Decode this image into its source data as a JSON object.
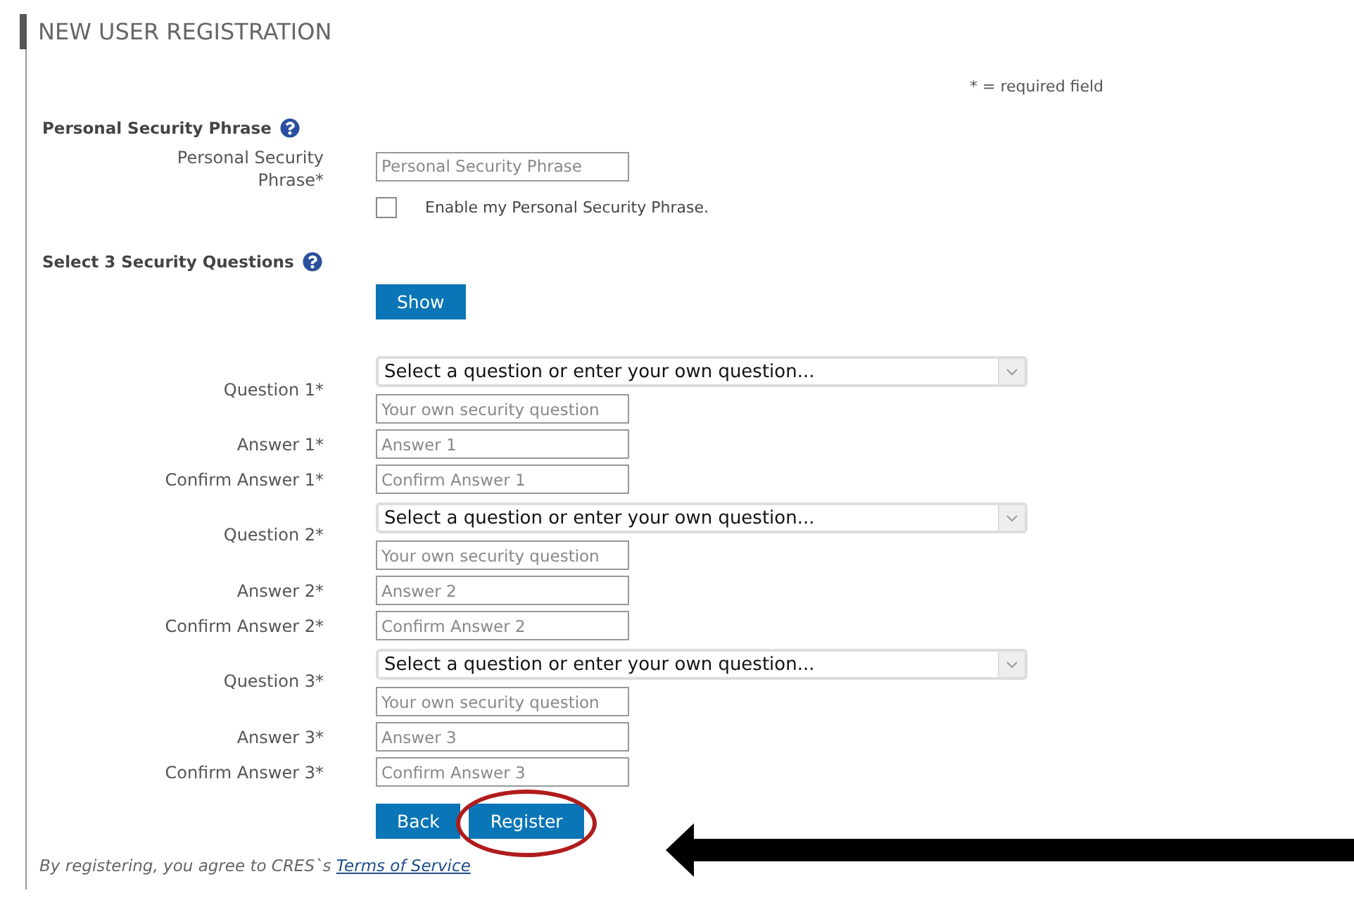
{
  "title": "NEW USER REGISTRATION",
  "required_note": "* = required field",
  "personal_phrase": {
    "heading": "Personal Security Phrase",
    "label": "Personal Security Phrase*",
    "placeholder": "Personal Security Phrase",
    "checkbox": {
      "label": "Enable my Personal Security Phrase.",
      "checked": false
    }
  },
  "security_questions": {
    "heading": "Select 3 Security Questions",
    "show_button": "Show",
    "questions": [
      {
        "label": "Question 1*",
        "select_value": "Select a question or enter your own question...",
        "own_placeholder": "Your own security question",
        "answer_label": "Answer 1*",
        "answer_placeholder": "Answer 1",
        "confirm_label": "Confirm Answer 1*",
        "confirm_placeholder": "Confirm Answer 1"
      },
      {
        "label": "Question 2*",
        "select_value": "Select a question or enter your own question...",
        "own_placeholder": "Your own security question",
        "answer_label": "Answer 2*",
        "answer_placeholder": "Answer 2",
        "confirm_label": "Confirm Answer 2*",
        "confirm_placeholder": "Confirm Answer 2"
      },
      {
        "label": "Question 3*",
        "select_value": "Select a question or enter your own question...",
        "own_placeholder": "Your own security question",
        "answer_label": "Answer 3*",
        "answer_placeholder": "Answer 3",
        "confirm_label": "Confirm Answer 3*",
        "confirm_placeholder": "Confirm Answer 3"
      }
    ]
  },
  "buttons": [
    {
      "label": "Back",
      "highlighted": false
    },
    {
      "label": "Register",
      "highlighted": true
    }
  ],
  "footer": {
    "text": "By registering, you agree to CRES`s ",
    "link": "Terms of Service"
  },
  "annotations": [
    {
      "kind": "arrow"
    }
  ]
}
